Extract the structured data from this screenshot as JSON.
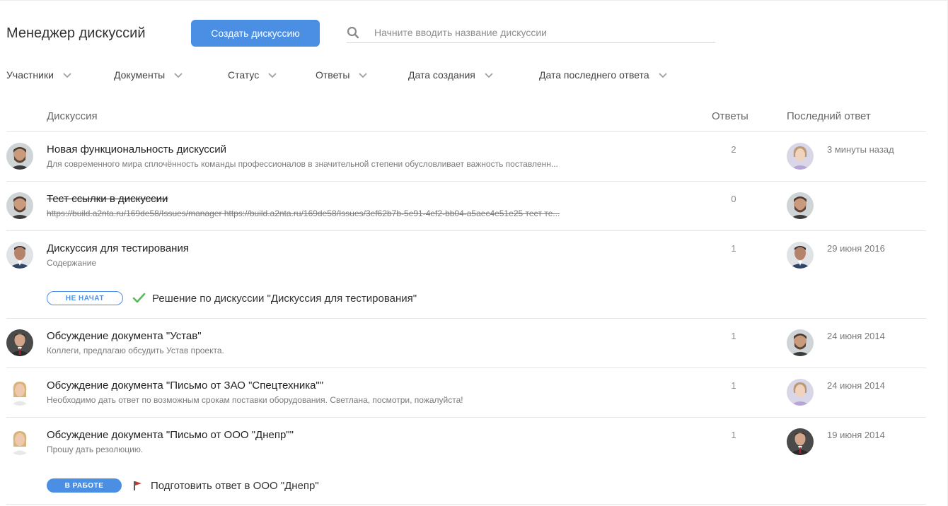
{
  "header": {
    "title": "Менеджер дискуссий",
    "create_label": "Создать дискуссию",
    "search_placeholder": "Начните вводить название дискуссии",
    "search_value": ""
  },
  "filters": [
    {
      "label": "Участники"
    },
    {
      "label": "Документы"
    },
    {
      "label": "Статус"
    },
    {
      "label": "Ответы"
    },
    {
      "label": "Дата создания"
    },
    {
      "label": "Дата последнего ответа"
    }
  ],
  "table": {
    "col_discussion": "Дискуссия",
    "col_replies": "Ответы",
    "col_last_reply": "Последний ответ"
  },
  "rows": [
    {
      "title": "Новая функциональность дискуссий",
      "description": "Для современного мира сплочённость команды профессионалов в значительной степени обусловливает важность поставленн...",
      "replies": "2",
      "last_reply": "3 минуты назад",
      "author_avatar": "man-beard",
      "last_avatar": "woman-light"
    },
    {
      "title": "Тест ссылки в дискуссии",
      "description": "https://build.a2nta.ru/169de58/Issues/manager https://build.a2nta.ru/169de58/Issues/3ef62b7b-5e91-4ef2-bb04-a5aec4e51e25 тест те...",
      "replies": "0",
      "last_reply": "",
      "author_avatar": "man-beard",
      "last_avatar": "man-beard"
    },
    {
      "title": "Дискуссия для тестирования",
      "description": "Содержание",
      "replies": "1",
      "last_reply": "29 июня 2016",
      "author_avatar": "man-dark",
      "last_avatar": "man-dark",
      "task": {
        "status": "НЕ НАЧАТ",
        "icon": "check-icon",
        "label": "Решение по дискуссии \"Дискуссия для тестирования\""
      }
    },
    {
      "title": "Обсуждение документа \"Устав\"",
      "description": "Коллеги, предлагаю обсудить Устав проекта.",
      "replies": "1",
      "last_reply": "24 июня 2014",
      "author_avatar": "man-suit",
      "last_avatar": "man-beard"
    },
    {
      "title": "Обсуждение документа \"Письмо от ЗАО \"Спецтехника\"\"",
      "description": "Необходимо дать ответ по возможным срокам поставки оборудования. Светлана, посмотри, пожалуйста!",
      "replies": "1",
      "last_reply": "24 июня 2014",
      "author_avatar": "woman-blonde",
      "last_avatar": "woman-light"
    },
    {
      "title": "Обсуждение документа \"Письмо от ООО \"Днепр\"\"",
      "description": "Прошу дать резолюцию.",
      "replies": "1",
      "last_reply": "19 июня 2014",
      "author_avatar": "woman-blonde",
      "last_avatar": "man-suit",
      "task": {
        "status": "В РАБОТЕ",
        "icon": "flag-icon",
        "label": "Подготовить ответ в ООО \"Днепр\""
      }
    }
  ],
  "colors": {
    "accent": "#4a8fe4",
    "check": "#5cb85c",
    "flag": "#c0392b"
  }
}
